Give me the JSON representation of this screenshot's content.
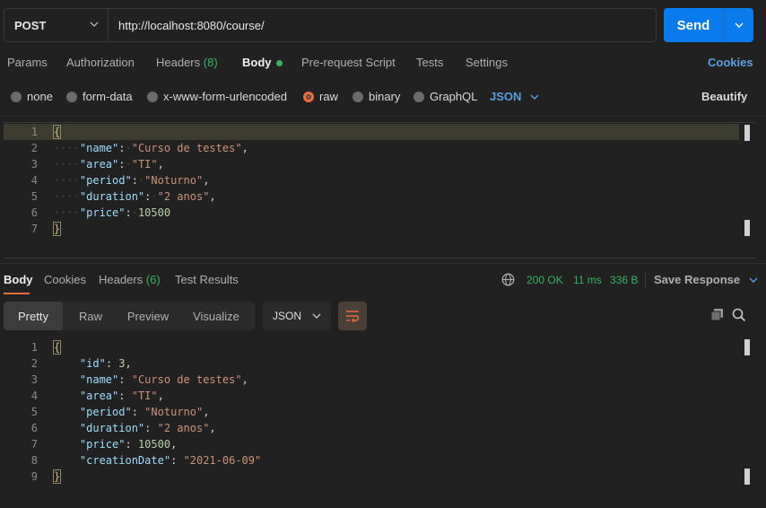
{
  "request": {
    "method": "POST",
    "url": "http://localhost:8080/course/",
    "send_label": "Send"
  },
  "request_tabs": {
    "params": "Params",
    "authorization": "Authorization",
    "headers": "Headers",
    "headers_count": "(8)",
    "body": "Body",
    "pre_request": "Pre-request Script",
    "tests": "Tests",
    "settings": "Settings",
    "cookies": "Cookies"
  },
  "body_types": {
    "none": "none",
    "form_data": "form-data",
    "urlencoded": "x-www-form-urlencoded",
    "raw": "raw",
    "binary": "binary",
    "graphql": "GraphQL",
    "format": "JSON",
    "beautify": "Beautify"
  },
  "request_body_lines": [
    {
      "n": "1",
      "text": "{"
    },
    {
      "n": "2",
      "key": "\"name\"",
      "value": "\"Curso de testes\"",
      "type": "str",
      "trail": ","
    },
    {
      "n": "3",
      "key": "\"area\"",
      "value": "\"TI\"",
      "type": "str",
      "trail": ","
    },
    {
      "n": "4",
      "key": "\"period\"",
      "value": "\"Noturno\"",
      "type": "str",
      "trail": ","
    },
    {
      "n": "5",
      "key": "\"duration\"",
      "value": "\"2 anos\"",
      "type": "str",
      "trail": ","
    },
    {
      "n": "6",
      "key": "\"price\"",
      "value": "10500",
      "type": "num",
      "trail": ""
    },
    {
      "n": "7",
      "text": "}"
    }
  ],
  "response_tabs": {
    "body": "Body",
    "cookies": "Cookies",
    "headers": "Headers",
    "headers_count": "(6)",
    "test_results": "Test Results"
  },
  "response_status": {
    "status": "200 OK",
    "time": "11 ms",
    "size": "336 B",
    "save": "Save Response"
  },
  "response_view": {
    "pretty": "Pretty",
    "raw": "Raw",
    "preview": "Preview",
    "visualize": "Visualize",
    "format": "JSON"
  },
  "response_body_lines": [
    {
      "n": "1",
      "text": "{"
    },
    {
      "n": "2",
      "key": "\"id\"",
      "value": "3",
      "type": "num",
      "trail": ","
    },
    {
      "n": "3",
      "key": "\"name\"",
      "value": "\"Curso de testes\"",
      "type": "str",
      "trail": ","
    },
    {
      "n": "4",
      "key": "\"area\"",
      "value": "\"TI\"",
      "type": "str",
      "trail": ","
    },
    {
      "n": "5",
      "key": "\"period\"",
      "value": "\"Noturno\"",
      "type": "str",
      "trail": ","
    },
    {
      "n": "6",
      "key": "\"duration\"",
      "value": "\"2 anos\"",
      "type": "str",
      "trail": ","
    },
    {
      "n": "7",
      "key": "\"price\"",
      "value": "10500",
      "type": "num",
      "trail": ","
    },
    {
      "n": "8",
      "key": "\"creationDate\"",
      "value": "\"2021-06-09\"",
      "type": "str",
      "trail": ""
    },
    {
      "n": "9",
      "text": "}"
    }
  ],
  "colors": {
    "accent_blue": "#097bed",
    "accent_orange": "#f26b3a",
    "status_green": "#33b460",
    "background": "#212121"
  }
}
